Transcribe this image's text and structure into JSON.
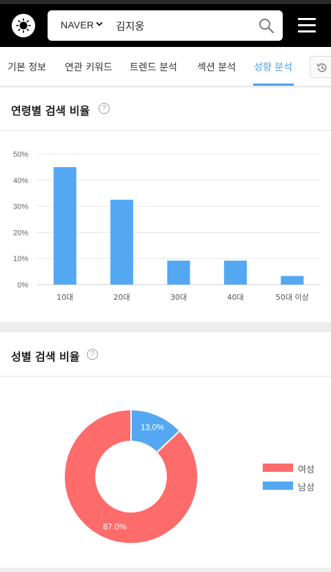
{
  "header": {
    "search_engine": "NAVER",
    "query": "김지웅"
  },
  "tabs": [
    {
      "label": "기본 정보",
      "active": false
    },
    {
      "label": "연관 키워드",
      "active": false
    },
    {
      "label": "트렌드 분석",
      "active": false
    },
    {
      "label": "섹션 분석",
      "active": false
    },
    {
      "label": "성향 분석",
      "active": true
    }
  ],
  "colors": {
    "accent": "#4a9fe8",
    "bar": "#54a8f2",
    "female": "#fe6b6b",
    "male": "#54a8f2"
  },
  "age_section": {
    "title": "연령별 검색 비율",
    "help": "?"
  },
  "gender_section": {
    "title": "성별 검색 비율",
    "help": "?"
  },
  "chart_data": [
    {
      "type": "bar",
      "categories": [
        "10대",
        "20대",
        "30대",
        "40대",
        "50대 이상"
      ],
      "values": [
        45,
        32.5,
        9.2,
        9.2,
        3.3
      ],
      "ylim": [
        0,
        50
      ],
      "yticks": [
        "0%",
        "10%",
        "20%",
        "30%",
        "40%",
        "50%"
      ],
      "grid": true
    },
    {
      "type": "pie",
      "donut": true,
      "slices": [
        {
          "name": "여성",
          "value": 87.0,
          "label": "87.0%",
          "color": "#fe6b6b"
        },
        {
          "name": "남성",
          "value": 13.0,
          "label": "13.0%",
          "color": "#54a8f2"
        }
      ],
      "legend": [
        {
          "name": "여성",
          "color": "#fe6b6b"
        },
        {
          "name": "남성",
          "color": "#54a8f2"
        }
      ],
      "legend_position": "right"
    }
  ]
}
